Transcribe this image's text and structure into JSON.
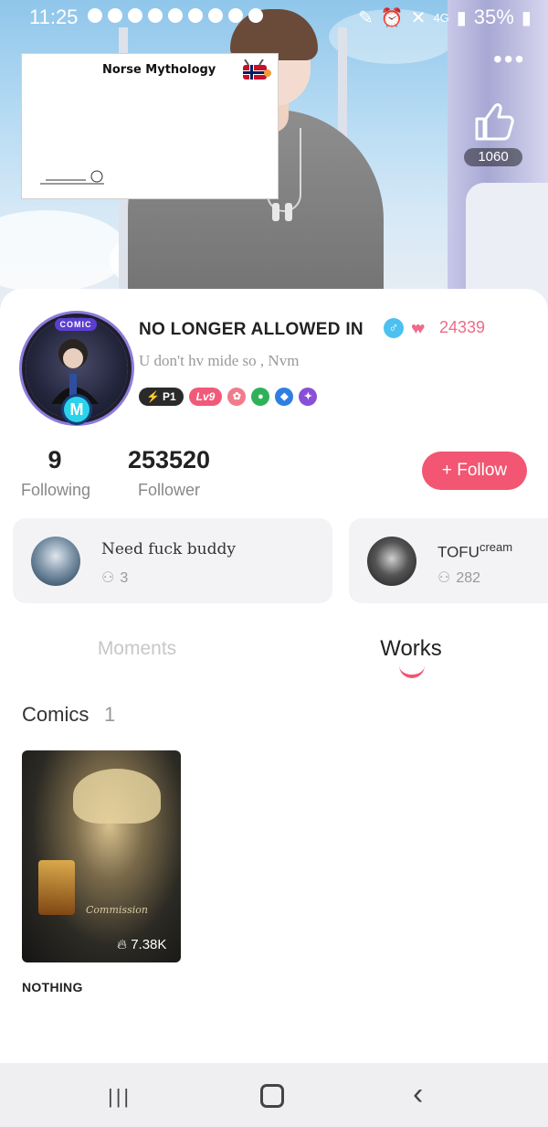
{
  "status_bar": {
    "time": "11:25",
    "network": "4G",
    "battery": "35%"
  },
  "header": {
    "banner_title": "Norse Mythology",
    "like_count": "1060"
  },
  "profile": {
    "username": "NO LONGER ALLOWED IN",
    "avatar_badge": "COMIC",
    "avatar_emblem": "M",
    "gender_symbol": "♂",
    "hearts_count": "24339",
    "bio": "U don't hv mide so , Nvm",
    "badges": {
      "p1": "P1",
      "level": "Lv9"
    }
  },
  "stats": {
    "following_count": "9",
    "following_label": "Following",
    "follower_count": "253520",
    "follower_label": "Follower"
  },
  "follow_button": {
    "plus": "+",
    "label": "Follow"
  },
  "groups": [
    {
      "name": "Need fuck buddy",
      "members": "3"
    },
    {
      "name": "TOFU",
      "name_sup": "cream",
      "members": "282"
    }
  ],
  "tabs": {
    "moments": "Moments",
    "works": "Works"
  },
  "section": {
    "title": "Comics",
    "count": "1"
  },
  "works": [
    {
      "title": "NOTHING",
      "views": "7.38K",
      "cover_text": "Commission"
    }
  ],
  "colors": {
    "accent": "#f25672",
    "hearts": "#f06a8a",
    "gender": "#4cc1f0"
  }
}
